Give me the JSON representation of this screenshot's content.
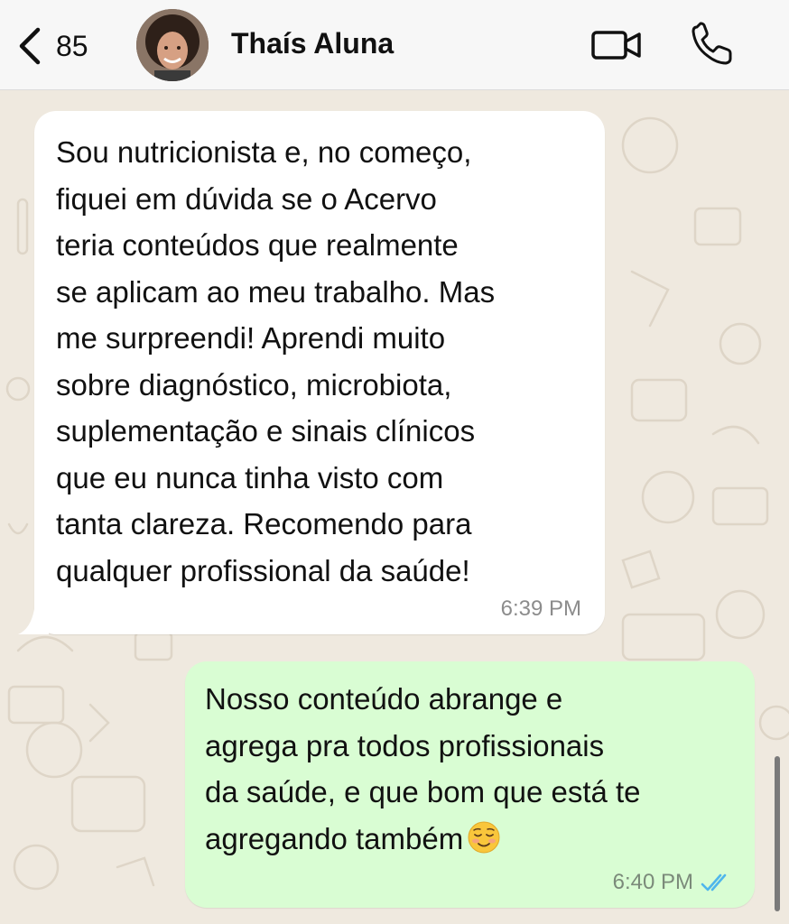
{
  "header": {
    "back_count": "85",
    "contact_name": "Thaís Aluna"
  },
  "messages": [
    {
      "direction": "incoming",
      "text": "Sou nutricionista e, no começo,\nfiquei em dúvida se o Acervo\nteria conteúdos que realmente\nse aplicam ao meu trabalho. Mas\nme surpreendi! Aprendi muito\nsobre diagnóstico, microbiota,\nsuplementação e sinais clínicos\nque eu nunca tinha visto com\ntanta clareza. Recomendo para\nqualquer profissional da saúde!",
      "time": "6:39 PM"
    },
    {
      "direction": "outgoing",
      "text": "Nosso conteúdo abrange e\nagrega pra todos profissionais\nda saúde, e que bom que está te\nagregando também",
      "emoji": "relieved-face",
      "time": "6:40 PM",
      "status": "read"
    }
  ],
  "colors": {
    "incoming_bubble": "#ffffff",
    "outgoing_bubble": "#d9fdd3",
    "read_ticks": "#4fb6ec",
    "chat_background": "#efe9df"
  },
  "icons": {
    "back": "chevron-left-icon",
    "video": "video-camera-icon",
    "phone": "phone-icon",
    "read_status": "double-check-icon"
  }
}
